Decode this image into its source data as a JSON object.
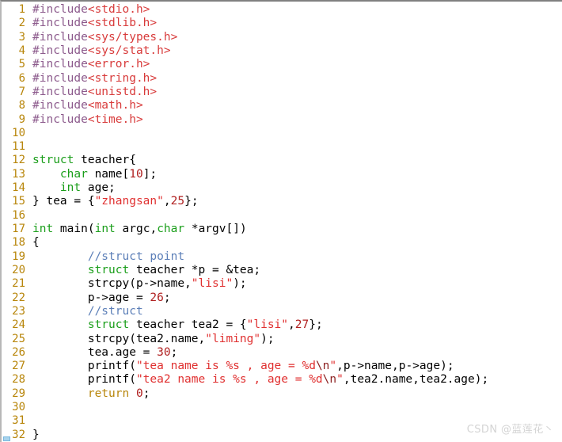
{
  "editor": {
    "language": "c",
    "first_line_number": 1,
    "last_line_number": 32,
    "colors": {
      "background": "#ffffff",
      "line_number": "#b8860b",
      "plain": "#000000",
      "preprocessor": "#8c5a8c",
      "header_name": "#d83b3b",
      "type_keyword": "#1a9e1a",
      "control_keyword": "#b8860b",
      "string": "#e03030",
      "escape": "#8b2020",
      "number": "#b02020",
      "comment": "#5c7fb8"
    }
  },
  "watermark": {
    "text": "CSDN @蓝莲花丶"
  },
  "code": {
    "lines": [
      {
        "n": "1",
        "tokens": [
          {
            "t": "#include",
            "c": "preproc"
          },
          {
            "t": "<stdio.h>",
            "c": "header"
          }
        ]
      },
      {
        "n": "2",
        "tokens": [
          {
            "t": "#include",
            "c": "preproc"
          },
          {
            "t": "<stdlib.h>",
            "c": "header"
          }
        ]
      },
      {
        "n": "3",
        "tokens": [
          {
            "t": "#include",
            "c": "preproc"
          },
          {
            "t": "<sys/types.h>",
            "c": "header"
          }
        ]
      },
      {
        "n": "4",
        "tokens": [
          {
            "t": "#include",
            "c": "preproc"
          },
          {
            "t": "<sys/stat.h>",
            "c": "header"
          }
        ]
      },
      {
        "n": "5",
        "tokens": [
          {
            "t": "#include",
            "c": "preproc"
          },
          {
            "t": "<error.h>",
            "c": "header"
          }
        ]
      },
      {
        "n": "6",
        "tokens": [
          {
            "t": "#include",
            "c": "preproc"
          },
          {
            "t": "<string.h>",
            "c": "header"
          }
        ]
      },
      {
        "n": "7",
        "tokens": [
          {
            "t": "#include",
            "c": "preproc"
          },
          {
            "t": "<unistd.h>",
            "c": "header"
          }
        ]
      },
      {
        "n": "8",
        "tokens": [
          {
            "t": "#include",
            "c": "preproc"
          },
          {
            "t": "<math.h>",
            "c": "header"
          }
        ]
      },
      {
        "n": "9",
        "tokens": [
          {
            "t": "#include",
            "c": "preproc"
          },
          {
            "t": "<time.h>",
            "c": "header"
          }
        ]
      },
      {
        "n": "10",
        "tokens": []
      },
      {
        "n": "11",
        "tokens": []
      },
      {
        "n": "12",
        "tokens": [
          {
            "t": "struct",
            "c": "keyword"
          },
          {
            "t": " teacher{",
            "c": "plain"
          }
        ]
      },
      {
        "n": "13",
        "tokens": [
          {
            "t": "    ",
            "c": "plain"
          },
          {
            "t": "char",
            "c": "keyword"
          },
          {
            "t": " name[",
            "c": "plain"
          },
          {
            "t": "10",
            "c": "number"
          },
          {
            "t": "];",
            "c": "plain"
          }
        ]
      },
      {
        "n": "14",
        "tokens": [
          {
            "t": "    ",
            "c": "plain"
          },
          {
            "t": "int",
            "c": "keyword"
          },
          {
            "t": " age;",
            "c": "plain"
          }
        ]
      },
      {
        "n": "15",
        "tokens": [
          {
            "t": "} tea = {",
            "c": "plain"
          },
          {
            "t": "\"zhangsan\"",
            "c": "string"
          },
          {
            "t": ",",
            "c": "plain"
          },
          {
            "t": "25",
            "c": "number"
          },
          {
            "t": "};",
            "c": "plain"
          }
        ]
      },
      {
        "n": "16",
        "tokens": []
      },
      {
        "n": "17",
        "tokens": [
          {
            "t": "int",
            "c": "keyword"
          },
          {
            "t": " main(",
            "c": "plain"
          },
          {
            "t": "int",
            "c": "keyword"
          },
          {
            "t": " argc,",
            "c": "plain"
          },
          {
            "t": "char",
            "c": "keyword"
          },
          {
            "t": " *argv[])",
            "c": "plain"
          }
        ]
      },
      {
        "n": "18",
        "tokens": [
          {
            "t": "{",
            "c": "plain"
          }
        ]
      },
      {
        "n": "19",
        "tokens": [
          {
            "t": "        ",
            "c": "plain"
          },
          {
            "t": "//struct point",
            "c": "comment"
          }
        ]
      },
      {
        "n": "20",
        "tokens": [
          {
            "t": "        ",
            "c": "plain"
          },
          {
            "t": "struct",
            "c": "keyword"
          },
          {
            "t": " teacher *p = &tea;",
            "c": "plain"
          }
        ]
      },
      {
        "n": "21",
        "tokens": [
          {
            "t": "        strcpy(p->name,",
            "c": "plain"
          },
          {
            "t": "\"lisi\"",
            "c": "string"
          },
          {
            "t": ");",
            "c": "plain"
          }
        ]
      },
      {
        "n": "22",
        "tokens": [
          {
            "t": "        p->age = ",
            "c": "plain"
          },
          {
            "t": "26",
            "c": "number"
          },
          {
            "t": ";",
            "c": "plain"
          }
        ]
      },
      {
        "n": "23",
        "tokens": [
          {
            "t": "        ",
            "c": "plain"
          },
          {
            "t": "//struct",
            "c": "comment"
          }
        ]
      },
      {
        "n": "24",
        "tokens": [
          {
            "t": "        ",
            "c": "plain"
          },
          {
            "t": "struct",
            "c": "keyword"
          },
          {
            "t": " teacher tea2 = {",
            "c": "plain"
          },
          {
            "t": "\"lisi\"",
            "c": "string"
          },
          {
            "t": ",",
            "c": "plain"
          },
          {
            "t": "27",
            "c": "number"
          },
          {
            "t": "};",
            "c": "plain"
          }
        ]
      },
      {
        "n": "25",
        "tokens": [
          {
            "t": "        strcpy(tea2.name,",
            "c": "plain"
          },
          {
            "t": "\"liming\"",
            "c": "string"
          },
          {
            "t": ");",
            "c": "plain"
          }
        ]
      },
      {
        "n": "26",
        "tokens": [
          {
            "t": "        tea.age = ",
            "c": "plain"
          },
          {
            "t": "30",
            "c": "number"
          },
          {
            "t": ";",
            "c": "plain"
          }
        ]
      },
      {
        "n": "27",
        "tokens": [
          {
            "t": "        printf(",
            "c": "plain"
          },
          {
            "t": "\"tea name is %s , age = %d",
            "c": "string"
          },
          {
            "t": "\\n",
            "c": "escape"
          },
          {
            "t": "\"",
            "c": "string"
          },
          {
            "t": ",p->name,p->age);",
            "c": "plain"
          }
        ]
      },
      {
        "n": "28",
        "tokens": [
          {
            "t": "        printf(",
            "c": "plain"
          },
          {
            "t": "\"tea2 name is %s , age = %d",
            "c": "string"
          },
          {
            "t": "\\n",
            "c": "escape"
          },
          {
            "t": "\"",
            "c": "string"
          },
          {
            "t": ",tea2.name,tea2.age);",
            "c": "plain"
          }
        ]
      },
      {
        "n": "29",
        "tokens": [
          {
            "t": "        ",
            "c": "plain"
          },
          {
            "t": "return",
            "c": "control"
          },
          {
            "t": " ",
            "c": "plain"
          },
          {
            "t": "0",
            "c": "number"
          },
          {
            "t": ";",
            "c": "plain"
          }
        ]
      },
      {
        "n": "30",
        "tokens": []
      },
      {
        "n": "31",
        "tokens": []
      },
      {
        "n": "32",
        "tokens": [
          {
            "t": "}",
            "c": "plain"
          }
        ]
      }
    ]
  }
}
